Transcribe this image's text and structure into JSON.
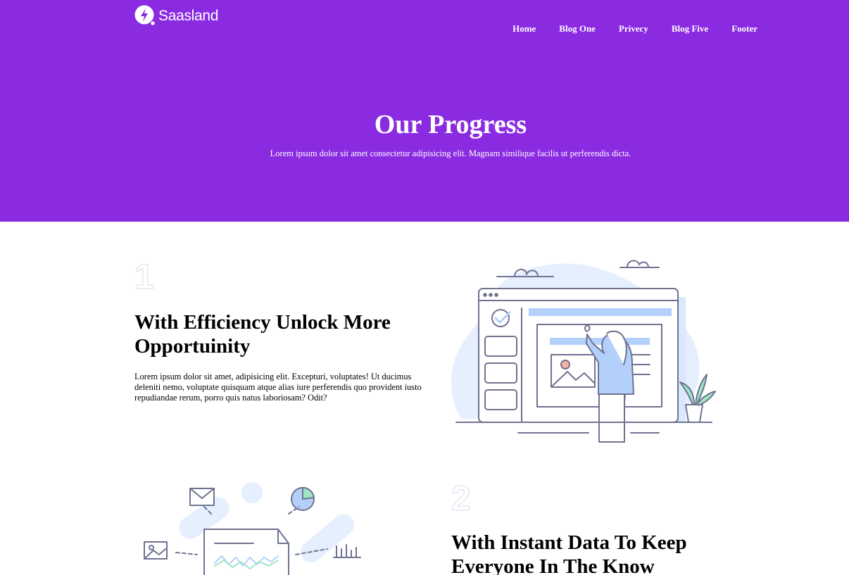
{
  "header": {
    "logo_text": "Saasland",
    "nav": [
      "Home",
      "Blog One",
      "Privecy",
      "Blog Five",
      "Footer"
    ]
  },
  "hero": {
    "title": "Our Progress",
    "subtitle": "Lorem ipsum dolor sit amet consectetur adipisicing elit. Magnam similique facilis ut perferendis dicta."
  },
  "features": [
    {
      "number": "1",
      "title_line1": "With Efficiency Unlock More",
      "title_line2": "Opportuinity",
      "text": "Lorem ipsum dolor sit amet, adipisicing elit. Excepturi, voluptates! Ut ducimus deleniti nemo, voluptate quisquam atque alias iure perferendis quo provident iusto repudiandae rerum, porro quis natus laboriosam? Odit?"
    },
    {
      "number": "2",
      "title_line1": "With Instant Data To Keep",
      "title_line2": "Everyone In The Know"
    }
  ],
  "colors": {
    "brand": "#8a2be2",
    "illustration_line": "#6f7390",
    "illustration_fill": "#e5effd",
    "illustration_accent": "#b3d0fb"
  }
}
